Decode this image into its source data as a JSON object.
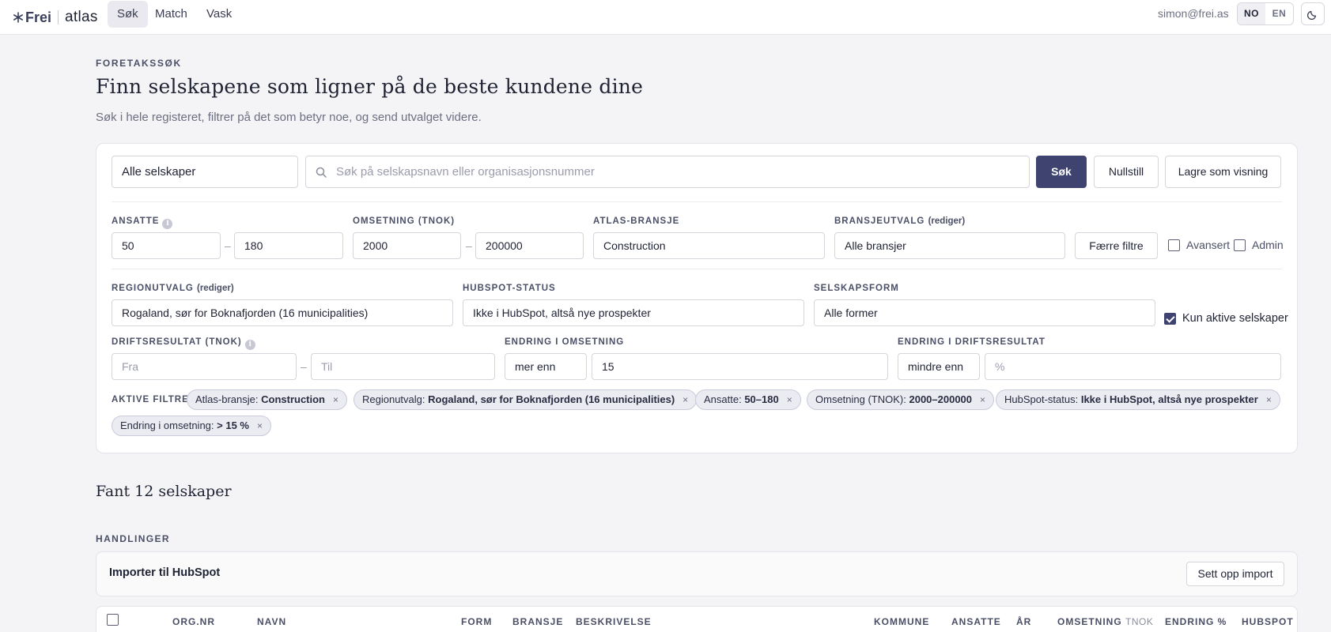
{
  "nav": {
    "brand": "Frei",
    "app": "atlas",
    "tabs": [
      {
        "label": "Søk",
        "active": true
      },
      {
        "label": "Match",
        "active": false
      },
      {
        "label": "Vask",
        "active": false
      }
    ],
    "user_email": "simon@frei.as",
    "lang_no": "NO",
    "lang_en": "EN",
    "active_lang": "NO",
    "theme_icon": "moon-icon"
  },
  "header": {
    "eyebrow": "FORETAKSSØK",
    "title": "Finn selskapene som ligner på de beste kundene dine",
    "subtitle": "Søk i hele registeret, filtrer på det som betyr noe, og send utvalget videre."
  },
  "search": {
    "scope": "Alle selskaper",
    "placeholder": "Søk på selskapsnavn eller organisasjonsnummer",
    "search_label": "Søk",
    "reset_label": "Nullstill",
    "save_label": "Lagre som visning"
  },
  "filters": {
    "employees": {
      "label": "ANSATTE",
      "from": "50",
      "to": "180"
    },
    "revenue": {
      "label": "OMSETNING (TNOK)",
      "from": "2000",
      "to": "200000"
    },
    "industry": {
      "label": "ATLAS-BRANSJE",
      "value": "Construction"
    },
    "industry_selection": {
      "label": "BRANSJEUTVALG",
      "edit": "(rediger)",
      "value": "Alle bransjer"
    },
    "fewer_filters_label": "Færre filtre",
    "advanced_label": "Avansert",
    "admin_label": "Admin",
    "region": {
      "label": "REGIONUTVALG",
      "edit": "(rediger)",
      "value": "Rogaland, sør for Boknafjorden (16 municipalities)"
    },
    "hubspot_status": {
      "label": "HUBSPOT-STATUS",
      "value": "Ikke i HubSpot, altså nye prospekter"
    },
    "company_form": {
      "label": "SELSKAPSFORM",
      "value": "Alle former"
    },
    "only_active": {
      "label": "Kun aktive selskaper",
      "checked": true
    },
    "operating_result": {
      "label": "DRIFTSRESULTAT (TNOK)",
      "from_placeholder": "Fra",
      "to_placeholder": "Til"
    },
    "revenue_change": {
      "label": "ENDRING I OMSETNING",
      "operator": "mer enn",
      "value": "15"
    },
    "result_change": {
      "label": "ENDRING I DRIFTSRESULTAT",
      "operator": "mindre enn",
      "placeholder": "%"
    },
    "dash": "–"
  },
  "active_filters": {
    "label": "AKTIVE FILTRE",
    "chips": [
      {
        "key": "Atlas-bransje:",
        "value": "Construction"
      },
      {
        "key": "Regionutvalg:",
        "value": "Rogaland, sør for Boknafjorden (16 municipalities)"
      },
      {
        "key": "Ansatte:",
        "value": "50–180"
      },
      {
        "key": "Omsetning (TNOK):",
        "value": "2000–200000"
      },
      {
        "key": "HubSpot-status:",
        "value": "Ikke i HubSpot, altså nye prospekter"
      },
      {
        "key": "Endring i omsetning:",
        "value": "> 15 %"
      }
    ],
    "remove_glyph": "×"
  },
  "results": {
    "prefix": "Fant",
    "count": "12",
    "suffix": "selskaper"
  },
  "actions": {
    "label": "HANDLINGER",
    "import_title": "Importer til HubSpot",
    "import_button": "Sett opp import"
  },
  "table": {
    "columns": [
      {
        "label": "ORG.NR"
      },
      {
        "label": "NAVN"
      },
      {
        "label": "FORM"
      },
      {
        "label": "BRANSJE"
      },
      {
        "label": "BESKRIVELSE"
      },
      {
        "label": "KOMMUNE"
      },
      {
        "label": "ANSATTE"
      },
      {
        "label": "ÅR"
      },
      {
        "label": "OMSETNING",
        "unit": "TNOK"
      },
      {
        "label": "ENDRING %"
      },
      {
        "label": "HUBSPOT"
      }
    ]
  }
}
